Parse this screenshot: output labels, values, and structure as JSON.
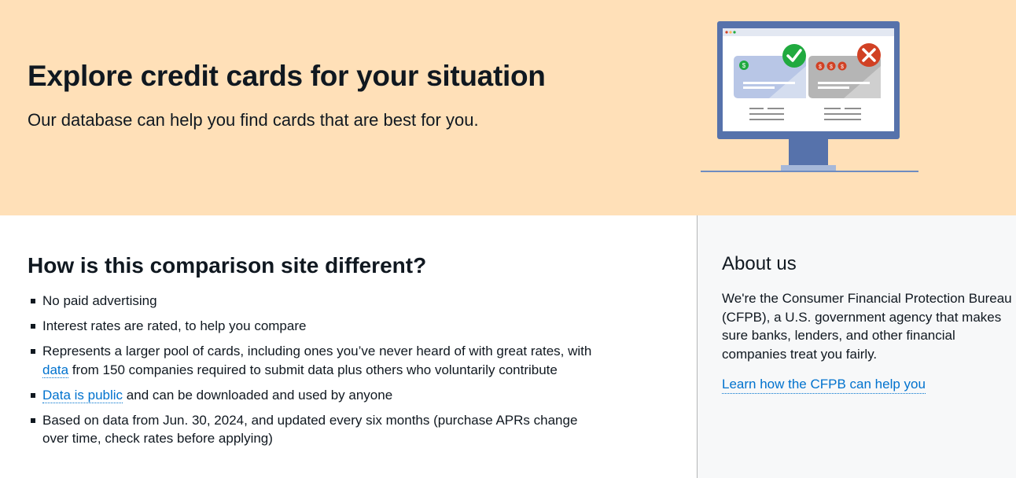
{
  "hero": {
    "title": "Explore credit cards for your situation",
    "subtitle": "Our database can help you find cards that are best for you."
  },
  "comparison": {
    "heading": "How is this comparison site different?",
    "items": [
      {
        "text": "No paid advertising"
      },
      {
        "text": "Interest rates are rated, to help you compare"
      },
      {
        "before": "Represents a larger pool of cards, including ones you’ve never heard of with great rates, with ",
        "link": "data",
        "after": " from 150 companies required to submit data plus others who voluntarily contribute"
      },
      {
        "before": "",
        "link": "Data is public",
        "after": " and can be downloaded and used by anyone"
      },
      {
        "text": "Based on data from Jun. 30, 2024, and updated every six months (purchase APRs change over time, check rates before applying)"
      }
    ]
  },
  "about": {
    "heading": "About us",
    "body": "We're the Consumer Financial Protection Bureau (CFPB), a U.S. government agency that makes sure banks, lenders, and other financial companies treat you fairly.",
    "link": "Learn how the CFPB can help you"
  },
  "colors": {
    "hero_bg": "#ffe0b8",
    "link": "#0072ce",
    "approve": "#20aa3f",
    "reject": "#d14124",
    "monitor": "#5672ab"
  },
  "icons": [
    "check-icon",
    "x-icon",
    "dollar-icon"
  ]
}
